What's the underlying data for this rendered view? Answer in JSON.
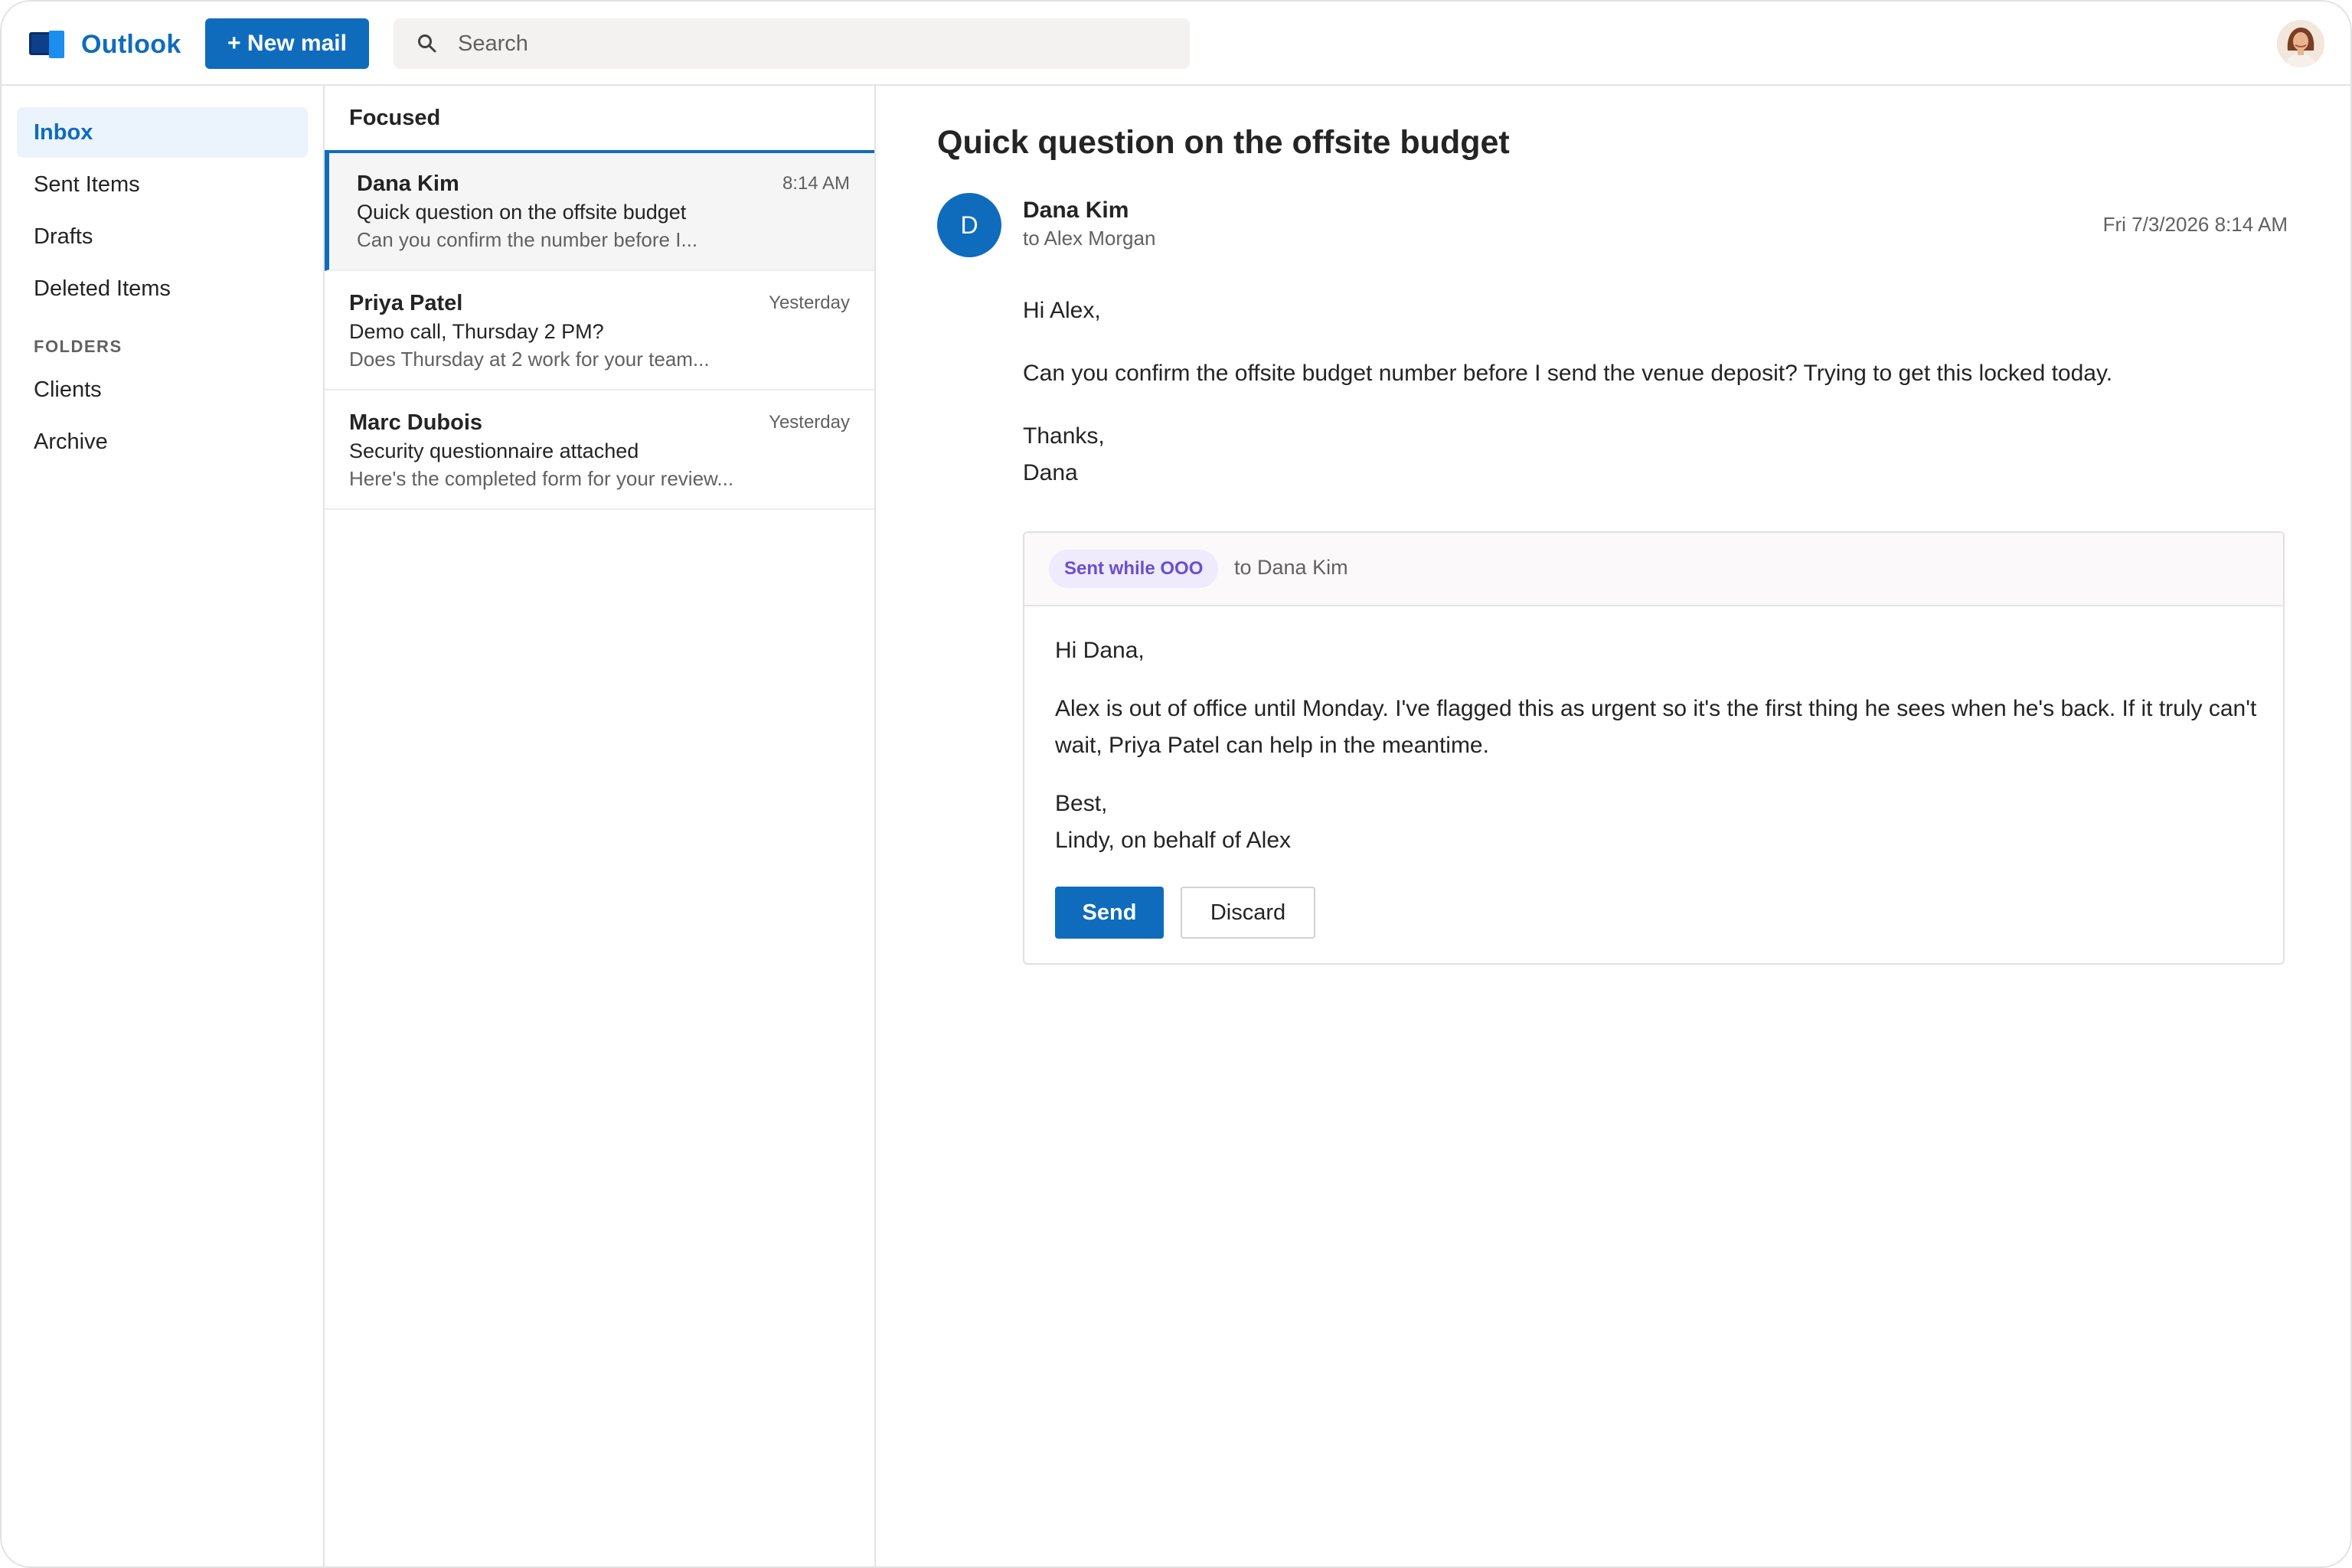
{
  "app": {
    "name": "Outlook"
  },
  "toolbar": {
    "new_mail_label": "+ New mail"
  },
  "search": {
    "placeholder": "Search"
  },
  "nav": {
    "items": [
      {
        "label": "Inbox",
        "active": true
      },
      {
        "label": "Sent Items"
      },
      {
        "label": "Drafts"
      },
      {
        "label": "Deleted Items"
      }
    ],
    "folders_heading": "FOLDERS",
    "folders": [
      {
        "label": "Clients"
      },
      {
        "label": "Archive"
      }
    ]
  },
  "list": {
    "header": "Focused",
    "messages": [
      {
        "from": "Dana Kim",
        "time": "8:14 AM",
        "subject": "Quick question on the offsite budget",
        "preview": "Can you confirm the number before I...",
        "selected": true
      },
      {
        "from": "Priya Patel",
        "time": "Yesterday",
        "subject": "Demo call, Thursday 2 PM?",
        "preview": "Does Thursday at 2 work for your team..."
      },
      {
        "from": "Marc Dubois",
        "time": "Yesterday",
        "subject": "Security questionnaire attached",
        "preview": "Here's the completed form for your review..."
      }
    ]
  },
  "reader": {
    "subject": "Quick question on the offsite budget",
    "sender_initial": "D",
    "sender_name": "Dana Kim",
    "to_line": "to Alex Morgan",
    "date": "Fri 7/3/2026 8:14 AM",
    "body": {
      "greeting": "Hi Alex,",
      "paragraph": "Can you confirm the offsite budget number before I send the venue deposit? Trying to get this locked today.",
      "signoff": "Thanks,",
      "signature": "Dana"
    }
  },
  "draft": {
    "badge": "Sent while OOO",
    "to_line": "to Dana Kim",
    "greeting": "Hi Dana,",
    "paragraph": "Alex is out of office until Monday. I've flagged this as urgent so it's the first thing he sees when he's back. If it truly can't wait, Priya Patel can help in the meantime.",
    "signoff": "Best,",
    "signature": "Lindy, on behalf of Alex",
    "send_label": "Send",
    "discard_label": "Discard"
  },
  "colors": {
    "accent": "#0f6cbd",
    "ooo_badge_bg": "#efeafc",
    "ooo_badge_text": "#6a4fd0"
  },
  "icons": [
    "outlook-logo-icon",
    "search-icon",
    "user-avatar"
  ]
}
